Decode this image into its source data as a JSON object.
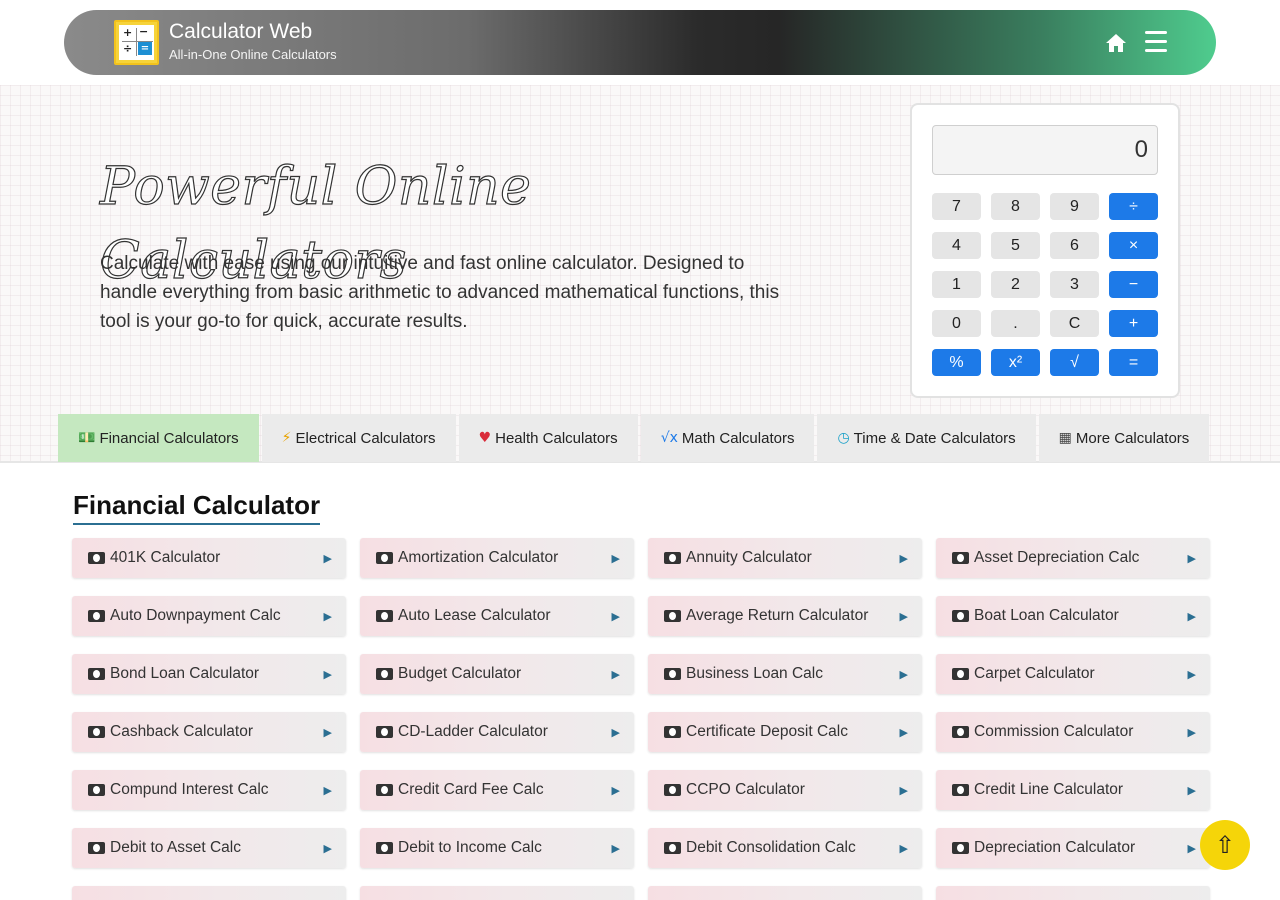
{
  "header": {
    "title": "Calculator Web",
    "subtitle": "All-in-One Online Calculators",
    "logo_glyphs": [
      "+",
      "−",
      "÷",
      "="
    ]
  },
  "hero": {
    "title": "Powerful Online Calculators",
    "description": "Calculate with ease using our intuitive and fast online calculator. Designed to handle everything from basic arithmetic to advanced mathematical functions, this tool is your go-to for quick, accurate results."
  },
  "calculator": {
    "display": "0",
    "keys": [
      {
        "label": "7",
        "op": false
      },
      {
        "label": "8",
        "op": false
      },
      {
        "label": "9",
        "op": false
      },
      {
        "label": "÷",
        "op": true
      },
      {
        "label": "4",
        "op": false
      },
      {
        "label": "5",
        "op": false
      },
      {
        "label": "6",
        "op": false
      },
      {
        "label": "×",
        "op": true
      },
      {
        "label": "1",
        "op": false
      },
      {
        "label": "2",
        "op": false
      },
      {
        "label": "3",
        "op": false
      },
      {
        "label": "−",
        "op": true
      },
      {
        "label": "0",
        "op": false
      },
      {
        "label": ".",
        "op": false
      },
      {
        "label": "C",
        "op": false
      },
      {
        "label": "+",
        "op": true
      },
      {
        "label": "%",
        "op": true
      },
      {
        "label": "x²",
        "op": true
      },
      {
        "label": "√",
        "op": true
      },
      {
        "label": "=",
        "op": true
      }
    ]
  },
  "tabs": [
    {
      "label": "Financial Calculators",
      "icon": "money-icon",
      "glyph": "💵",
      "color": "#2f8a3a",
      "active": true
    },
    {
      "label": "Electrical Calculators",
      "icon": "bolt-icon",
      "glyph": "⚡",
      "color": "#e8a300",
      "active": false
    },
    {
      "label": "Health Calculators",
      "icon": "heartbeat-icon",
      "glyph": "♥",
      "color": "#d92c3a",
      "active": false
    },
    {
      "label": "Math Calculators",
      "icon": "square-root-icon",
      "glyph": "√x",
      "color": "#1d7ae8",
      "active": false
    },
    {
      "label": "Time & Date Calculators",
      "icon": "clock-icon",
      "glyph": "◷",
      "color": "#1aa0c8",
      "active": false
    },
    {
      "label": "More Calculators",
      "icon": "calculator-icon",
      "glyph": "▦",
      "color": "#444444",
      "active": false
    }
  ],
  "section": {
    "title": "Financial Calculator"
  },
  "calculators": [
    "401K Calculator",
    "Amortization Calculator",
    "Annuity Calculator",
    "Asset Depreciation Calc",
    "Auto Downpayment Calc",
    "Auto Lease Calculator",
    "Average Return Calculator",
    "Boat Loan Calculator",
    "Bond Loan Calculator",
    "Budget Calculator",
    "Business Loan Calc",
    "Carpet Calculator",
    "Cashback Calculator",
    "CD-Ladder Calculator",
    "Certificate Deposit Calc",
    "Commission Calculator",
    "Compund Interest Calc",
    "Credit Card Fee Calc",
    "CCPO Calculator",
    "Credit Line Calculator",
    "Debit to Asset Calc",
    "Debit to Income Calc",
    "Debit Consolidation Calc",
    "Depreciation Calculator",
    "",
    "",
    "",
    ""
  ],
  "card_arrow": "▶",
  "scroll_top": "⇧",
  "colors": {
    "accent": "#1d7ae8",
    "active_tab": "#c5e8c0",
    "scroll_button": "#f5d509"
  }
}
